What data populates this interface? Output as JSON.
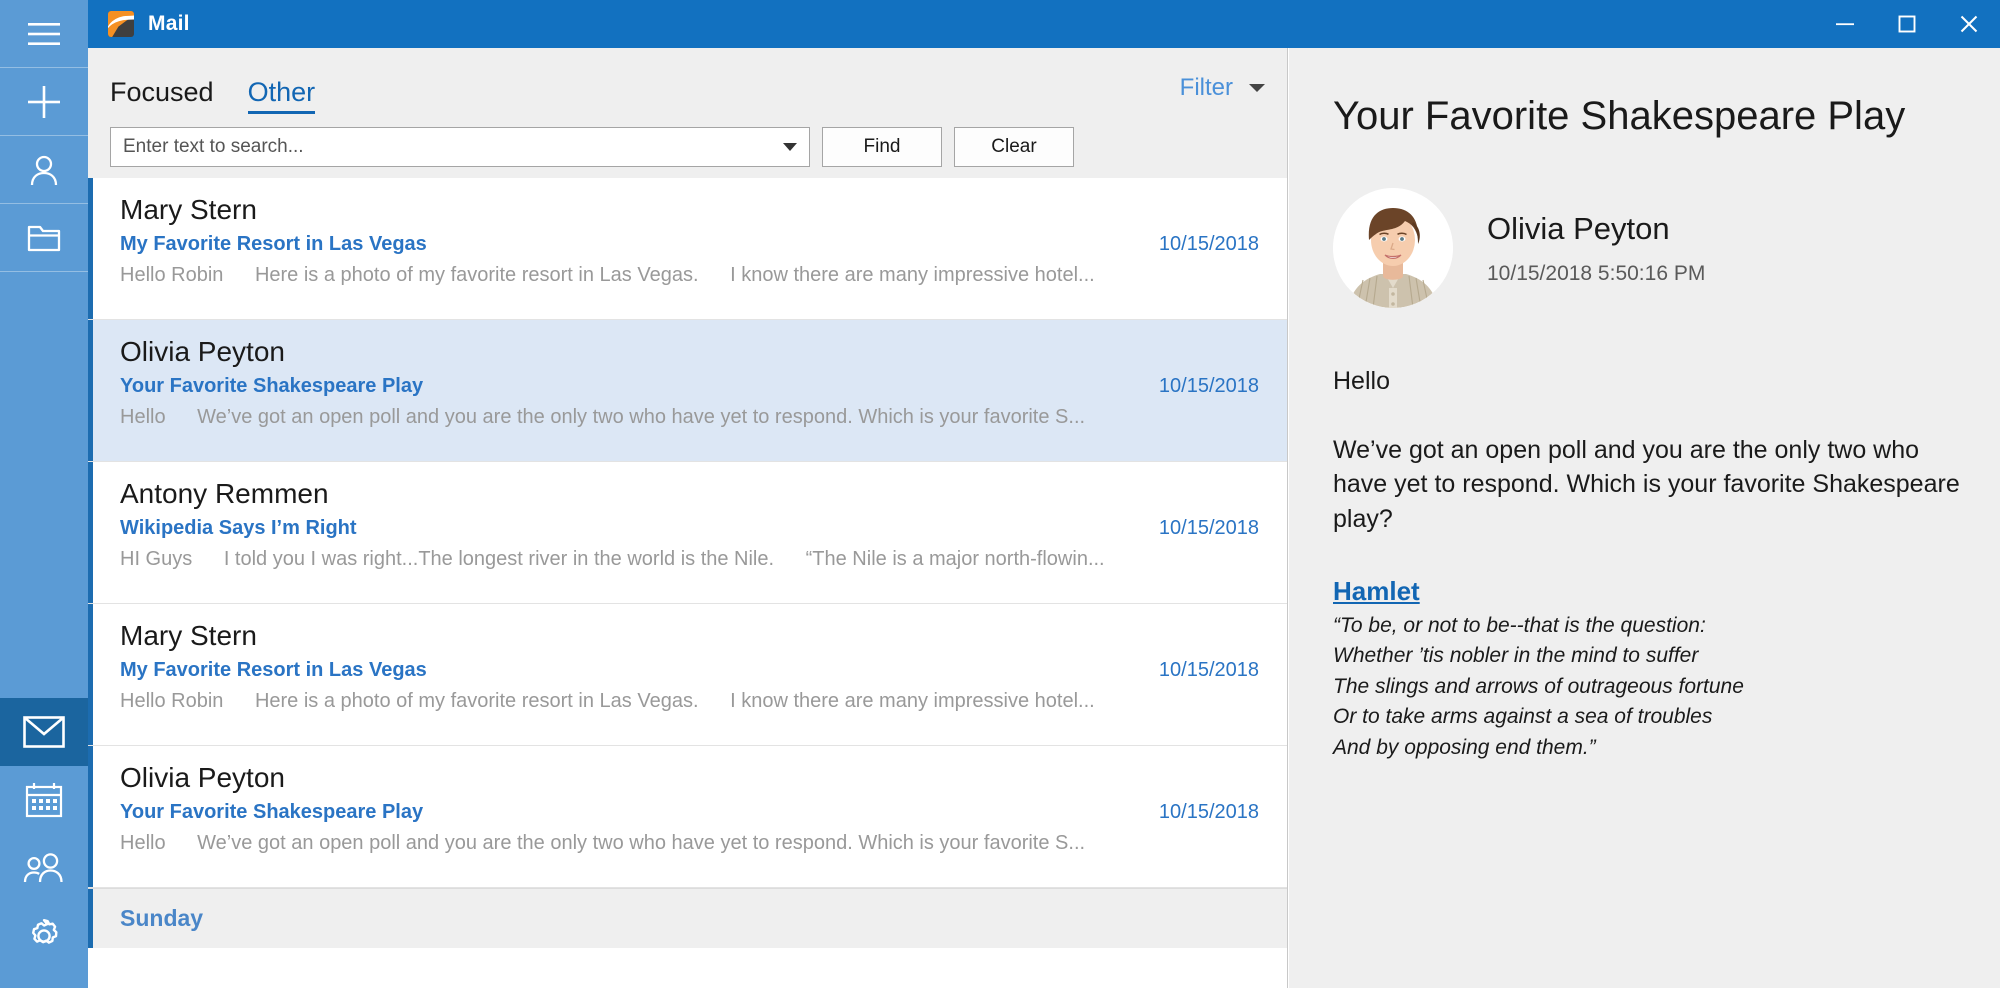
{
  "window": {
    "app_title": "Mail",
    "logo_icon": "mail-app-logo",
    "accent_color": "#1271c0",
    "rail_color": "#5b9bd5",
    "controls": [
      {
        "name": "minimize-button",
        "glyph": "minimize-icon"
      },
      {
        "name": "maximize-button",
        "glyph": "maximize-icon"
      },
      {
        "name": "close-button",
        "glyph": "close-icon"
      }
    ]
  },
  "rail": {
    "top_items": [
      {
        "name": "hamburger-menu-button",
        "icon": "hamburger-icon"
      },
      {
        "name": "new-mail-button",
        "icon": "plus-icon"
      },
      {
        "name": "account-button",
        "icon": "person-icon"
      },
      {
        "name": "folders-button",
        "icon": "folder-icon"
      }
    ],
    "bottom_items": [
      {
        "name": "mail-button",
        "icon": "envelope-icon",
        "active": true
      },
      {
        "name": "calendar-button",
        "icon": "calendar-icon",
        "active": false
      },
      {
        "name": "people-button",
        "icon": "people-icon",
        "active": false
      },
      {
        "name": "settings-button",
        "icon": "gear-icon",
        "active": false
      }
    ]
  },
  "list_header": {
    "tabs": [
      {
        "label": "Focused",
        "active": false
      },
      {
        "label": "Other",
        "active": true
      }
    ],
    "filter_label": "Filter",
    "filter_icon": "chevron-down-icon"
  },
  "search": {
    "placeholder": "Enter text to search...",
    "value": "",
    "dropdown_icon": "chevron-down-icon",
    "find_label": "Find",
    "clear_label": "Clear"
  },
  "messages": [
    {
      "sender": "Mary Stern",
      "subject": "My Favorite Resort in Las Vegas",
      "date": "10/15/2018",
      "preview_1": "Hello Robin",
      "preview_2": "Here is a photo of my favorite resort in Las Vegas.",
      "preview_3": "I know there are many impressive hotel...",
      "selected": false
    },
    {
      "sender": "Olivia Peyton",
      "subject": "Your Favorite Shakespeare Play",
      "date": "10/15/2018",
      "preview_1": "Hello",
      "preview_2": "We’ve got an open poll and you are the only two who have yet to respond. Which is your favorite S...",
      "preview_3": "",
      "selected": true
    },
    {
      "sender": "Antony Remmen",
      "subject": "Wikipedia Says I’m Right",
      "date": "10/15/2018",
      "preview_1": "HI Guys",
      "preview_2": "I told you I was right...The longest river in the world is the Nile.",
      "preview_3": "“The Nile is a major north-flowin...",
      "selected": false
    },
    {
      "sender": "Mary Stern",
      "subject": "My Favorite Resort in Las Vegas",
      "date": "10/15/2018",
      "preview_1": "Hello Robin",
      "preview_2": "Here is a photo of my favorite resort in Las Vegas.",
      "preview_3": "I know there are many impressive hotel...",
      "selected": false
    },
    {
      "sender": "Olivia Peyton",
      "subject": "Your Favorite Shakespeare Play",
      "date": "10/15/2018",
      "preview_1": "Hello",
      "preview_2": "We’ve got an open poll and you are the only two who have yet to respond. Which is your favorite S...",
      "preview_3": "",
      "selected": false
    }
  ],
  "day_group": {
    "label": "Sunday"
  },
  "reading_pane": {
    "subject": "Your Favorite Shakespeare Play",
    "avatar_icon": "contact-photo-olivia-peyton",
    "from_name": "Olivia Peyton",
    "timestamp": "10/15/2018 5:50:16 PM",
    "greeting": "Hello",
    "paragraph": "We’ve got an open poll and you are the only two who have yet to respond. Which is your favorite Shakespeare play?",
    "play_link": "Hamlet",
    "quote_lines": [
      "“To be, or not to be--that is the question:",
      "Whether ’tis nobler in the mind to suffer",
      "The slings and arrows of outrageous fortune",
      "Or to take arms against a sea of troubles",
      "And by opposing end them.”"
    ]
  }
}
